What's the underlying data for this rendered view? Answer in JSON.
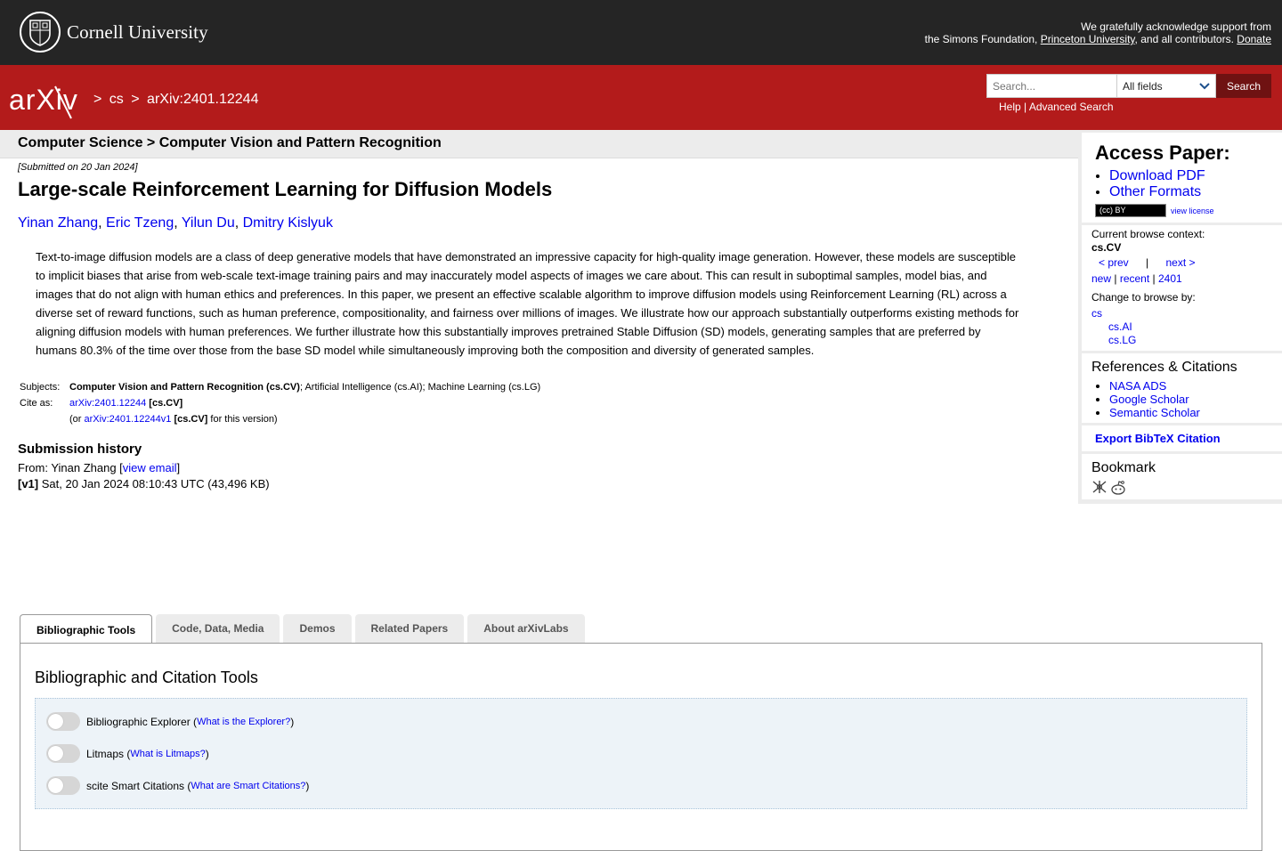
{
  "top_bar": {
    "university": "Cornell University",
    "support_line1": "We gratefully acknowledge support from",
    "support_prefix": "the Simons Foundation,",
    "support_princeton": "Princeton University",
    "support_middle": ", and all contributors.",
    "support_donate": "Donate"
  },
  "header": {
    "logo_text": "arXiv",
    "crumb_sep": ">",
    "crumb_cs": "cs",
    "crumb_id": "arXiv:2401.12244",
    "search_placeholder": "Search...",
    "search_field": "All fields",
    "search_button": "Search",
    "help": "Help",
    "help_sep": "|",
    "advanced_search": "Advanced Search"
  },
  "subheader": "Computer Science > Computer Vision and Pattern Recognition",
  "paper": {
    "submitted": "[Submitted on 20 Jan 2024]",
    "title": "Large-scale Reinforcement Learning for Diffusion Models",
    "authors": [
      "Yinan Zhang",
      "Eric Tzeng",
      "Yilun Du",
      "Dmitry Kislyuk"
    ],
    "abstract": "Text-to-image diffusion models are a class of deep generative models that have demonstrated an impressive capacity for high-quality image generation. However, these models are susceptible to implicit biases that arise from web-scale text-image training pairs and may inaccurately model aspects of images we care about. This can result in suboptimal samples, model bias, and images that do not align with human ethics and preferences. In this paper, we present an effective scalable algorithm to improve diffusion models using Reinforcement Learning (RL) across a diverse set of reward functions, such as human preference, compositionality, and fairness over millions of images. We illustrate how our approach substantially outperforms existing methods for aligning diffusion models with human preferences. We further illustrate how this substantially improves pretrained Stable Diffusion (SD) models, generating samples that are preferred by humans 80.3% of the time over those from the base SD model while simultaneously improving both the composition and diversity of generated samples.",
    "subjects_label": "Subjects:",
    "subjects_primary": "Computer Vision and Pattern Recognition (cs.CV)",
    "subjects_rest": "; Artificial Intelligence (cs.AI); Machine Learning (cs.LG)",
    "cite_label": "Cite as:",
    "cite_id": "arXiv:2401.12244",
    "cite_cat": "[cs.CV]",
    "cite_or": "(or",
    "cite_version_id": "arXiv:2401.12244v1",
    "cite_version_cat": "[cs.CV]",
    "cite_version_tail": "for this version)",
    "history_title": "Submission history",
    "history_from": "From: Yinan Zhang [",
    "history_email": "view email",
    "history_close": "]",
    "history_v1_label": "[v1]",
    "history_v1": "Sat, 20 Jan 2024 08:10:43 UTC (43,496 KB)"
  },
  "sidebar": {
    "access_title": "Access Paper:",
    "download_pdf": "Download PDF",
    "other_formats": "Other Formats",
    "license_badge": "(cc) BY",
    "view_license": "view license",
    "browse_context_label": "Current browse context:",
    "browse_context": "cs.CV",
    "prev": "< prev",
    "nav_sep": "|",
    "next": "next >",
    "new": "new",
    "recent": "recent",
    "year": "2401",
    "change_browse": "Change to browse by:",
    "browse_cs": "cs",
    "browse_ai": "cs.AI",
    "browse_lg": "cs.LG",
    "refs_title": "References & Citations",
    "refs": [
      "NASA ADS",
      "Google Scholar",
      "Semantic Scholar"
    ],
    "bibtex": "Export BibTeX Citation",
    "bookmark_title": "Bookmark"
  },
  "tabs": [
    "Bibliographic Tools",
    "Code, Data, Media",
    "Demos",
    "Related Papers",
    "About arXivLabs"
  ],
  "tools": {
    "title": "Bibliographic and Citation Tools",
    "items": [
      {
        "label": "Bibliographic Explorer (",
        "link": "What is the Explorer?",
        "close": ")",
        "enabled": false
      },
      {
        "label": "Litmaps (",
        "link": "What is Litmaps?",
        "close": ")",
        "enabled": false
      },
      {
        "label": "scite Smart Citations (",
        "link": "What are Smart Citations?",
        "close": ")",
        "enabled": false
      }
    ]
  },
  "colors": {
    "arxiv_red": "#b31b1b",
    "top_bar": "#252525",
    "link": "#0000ee",
    "search_button": "#6f1212"
  }
}
